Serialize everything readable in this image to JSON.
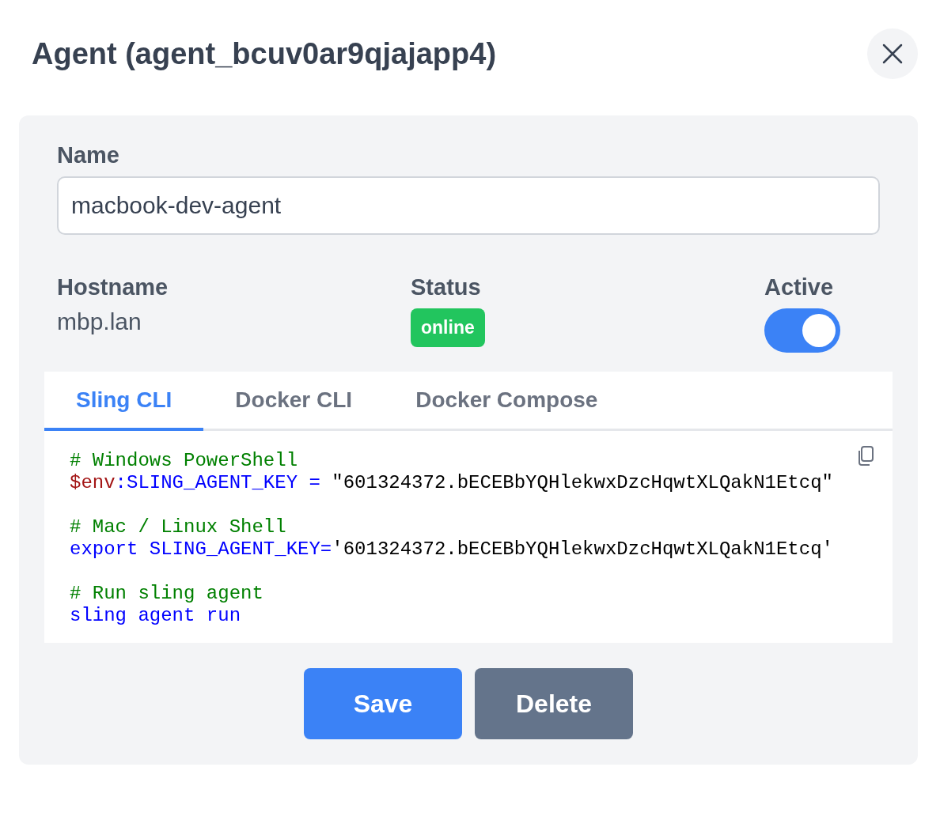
{
  "dialog": {
    "title": "Agent (agent_bcuv0ar9qjajapp4)"
  },
  "name_field": {
    "label": "Name",
    "value": "macbook-dev-agent"
  },
  "hostname": {
    "label": "Hostname",
    "value": "mbp.lan"
  },
  "status": {
    "label": "Status",
    "value": "online"
  },
  "active": {
    "label": "Active",
    "on": true
  },
  "tabs": [
    {
      "label": "Sling CLI",
      "selected": true
    },
    {
      "label": "Docker CLI",
      "selected": false
    },
    {
      "label": "Docker Compose",
      "selected": false
    }
  ],
  "code_blocks": [
    [
      [
        {
          "kind": "comment",
          "text": "# Windows PowerShell"
        }
      ],
      [
        {
          "kind": "variable",
          "text": "$env"
        },
        {
          "kind": "keyword",
          "text": ":SLING_AGENT_KEY = "
        },
        {
          "kind": "string",
          "text": "\"601324372.bECEBbYQHlekwxDzcHqwtXLQakN1Etcq\""
        }
      ]
    ],
    [
      [
        {
          "kind": "comment",
          "text": "# Mac / Linux Shell"
        }
      ],
      [
        {
          "kind": "keyword",
          "text": "export SLING_AGENT_KEY="
        },
        {
          "kind": "string",
          "text": "'601324372.bECEBbYQHlekwxDzcHqwtXLQakN1Etcq'"
        }
      ]
    ],
    [
      [
        {
          "kind": "comment",
          "text": "# Run sling agent"
        }
      ],
      [
        {
          "kind": "keyword",
          "text": "sling agent run"
        }
      ]
    ]
  ],
  "buttons": [
    {
      "label": "Save",
      "kind": "primary"
    },
    {
      "label": "Delete",
      "kind": "secondary"
    }
  ]
}
